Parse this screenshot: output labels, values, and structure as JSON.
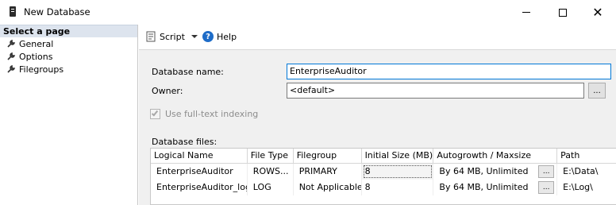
{
  "window": {
    "title": "New Database",
    "icons": {
      "app": "database-server-icon",
      "minimize": "minimize-icon",
      "maximize": "maximize-icon",
      "close": "close-icon"
    }
  },
  "left_pane": {
    "header": "Select a page",
    "items": [
      {
        "label": "General",
        "icon": "wrench-icon",
        "selected": true
      },
      {
        "label": "Options",
        "icon": "wrench-icon",
        "selected": false
      },
      {
        "label": "Filegroups",
        "icon": "wrench-icon",
        "selected": false
      }
    ]
  },
  "toolbar": {
    "script_label": "Script",
    "help_label": "Help",
    "help_glyph": "?"
  },
  "form": {
    "database_name_label": "Database name:",
    "database_name_value": "EnterpriseAuditor",
    "owner_label": "Owner:",
    "owner_value": "<default>",
    "browse_label": "...",
    "fulltext_label": "Use full-text indexing",
    "fulltext_checked": true,
    "fulltext_enabled": false,
    "database_files_label": "Database files:"
  },
  "files_table": {
    "columns": [
      "Logical Name",
      "File Type",
      "Filegroup",
      "Initial Size (MB)",
      "Autogrowth / Maxsize",
      "Path"
    ],
    "rows": [
      {
        "logical_name": "EnterpriseAuditor",
        "file_type": "ROWS...",
        "filegroup": "PRIMARY",
        "initial_size": "8",
        "autogrowth": "By 64 MB, Unlimited",
        "browse": "...",
        "path": "E:\\Data\\"
      },
      {
        "logical_name": "EnterpriseAuditor_log",
        "file_type": "LOG",
        "filegroup": "Not Applicable",
        "initial_size": "8",
        "autogrowth": "By 64 MB, Unlimited",
        "browse": "...",
        "path": "E:\\Log\\"
      }
    ]
  }
}
